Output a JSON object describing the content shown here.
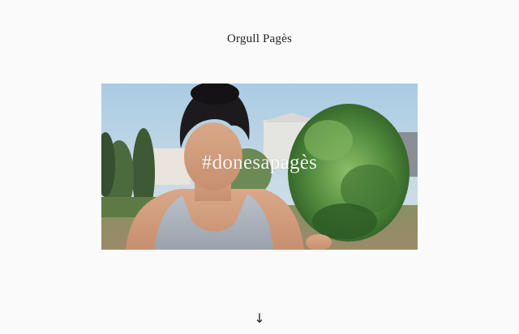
{
  "header": {
    "title": "Orgull Pagès"
  },
  "hero": {
    "hashtag": "#donesapagès",
    "image_alt": "woman-holding-lettuce-photo"
  },
  "footer": {
    "scroll_icon": "↓"
  },
  "colors": {
    "background": "#fafafa",
    "text": "#222222"
  }
}
